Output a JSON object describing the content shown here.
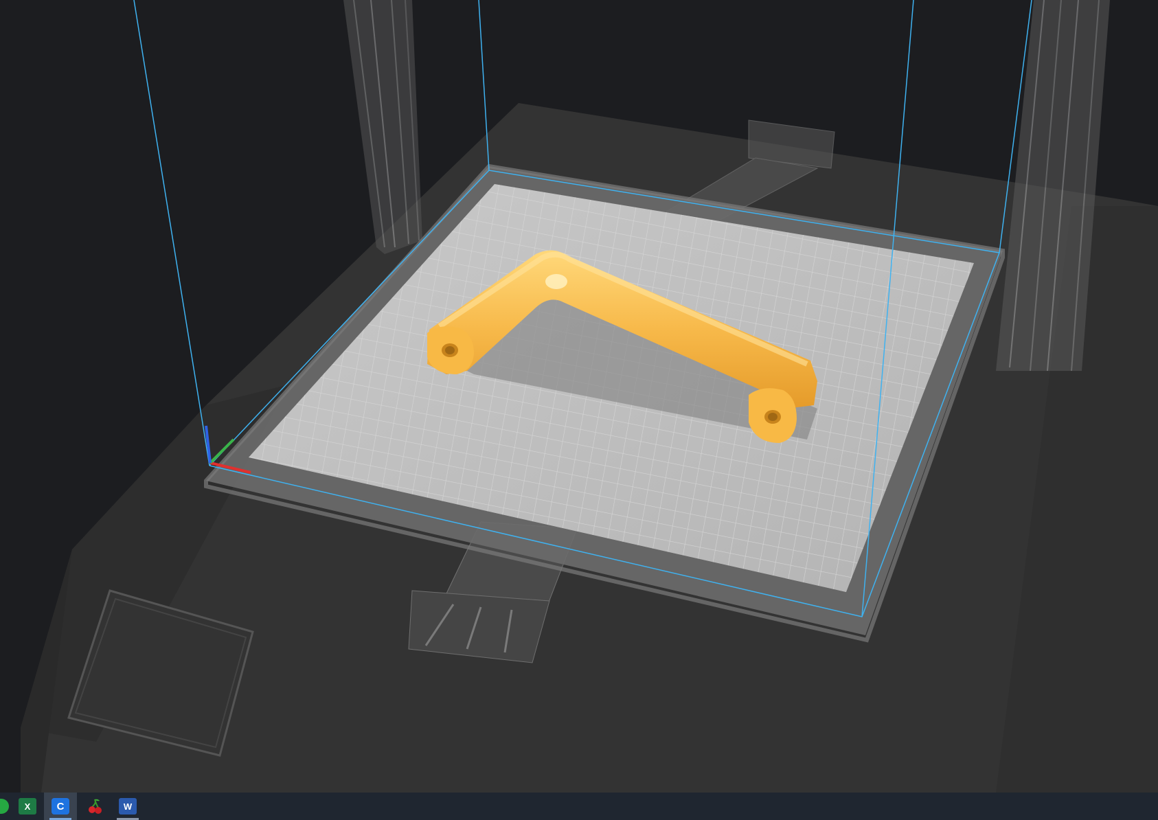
{
  "window": {
    "app": "Ultimaker Cura"
  },
  "viewport": {
    "background": "#1c1d20",
    "model_color": "#f7b94a",
    "build_volume_line_color": "#3fb2f0",
    "axis_colors": {
      "x": "#e0312f",
      "y": "#3ab44a",
      "z": "#2e63e6"
    }
  },
  "taskbar": {
    "background": "#1f2630",
    "items": [
      {
        "name": "green-app-icon",
        "label": ""
      },
      {
        "name": "excel-icon",
        "label": "X"
      },
      {
        "name": "cura-icon",
        "label": "C",
        "active": true
      },
      {
        "name": "cherry-icon",
        "label": ""
      },
      {
        "name": "word-icon",
        "label": "W"
      }
    ]
  }
}
